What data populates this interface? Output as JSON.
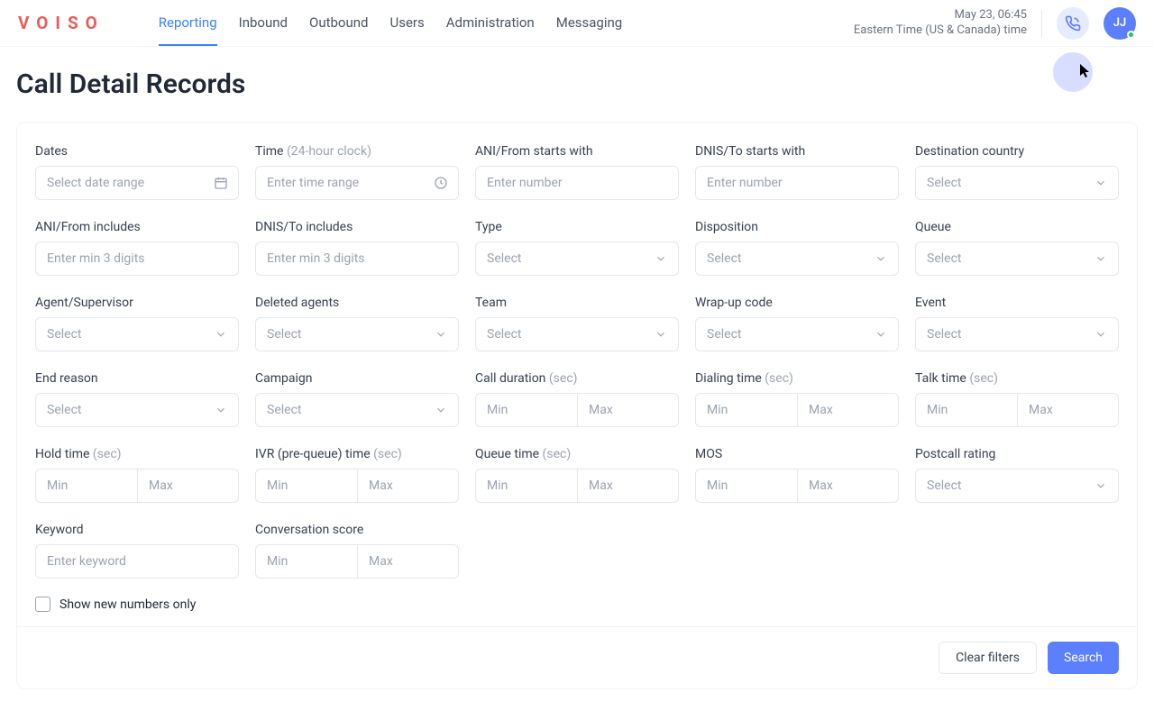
{
  "header": {
    "logo": "VOISO",
    "nav": [
      "Reporting",
      "Inbound",
      "Outbound",
      "Users",
      "Administration",
      "Messaging"
    ],
    "datetime": {
      "line1": "May 23, 06:45",
      "line2": "Eastern Time (US & Canada) time"
    },
    "avatar_initials": "JJ"
  },
  "page": {
    "title": "Call Detail Records"
  },
  "filters": {
    "dates": {
      "label": "Dates",
      "placeholder": "Select date range"
    },
    "time": {
      "label": "Time ",
      "hint": "(24-hour clock)",
      "placeholder": "Enter time range"
    },
    "ani_starts": {
      "label": "ANI/From starts with",
      "placeholder": "Enter number"
    },
    "dnis_starts": {
      "label": "DNIS/To starts with",
      "placeholder": "Enter number"
    },
    "dest_country": {
      "label": "Destination country",
      "placeholder": "Select"
    },
    "ani_includes": {
      "label": "ANI/From includes",
      "placeholder": "Enter min 3 digits"
    },
    "dnis_includes": {
      "label": "DNIS/To includes",
      "placeholder": "Enter min 3 digits"
    },
    "type": {
      "label": "Type",
      "placeholder": "Select"
    },
    "disposition": {
      "label": "Disposition",
      "placeholder": "Select"
    },
    "queue": {
      "label": "Queue",
      "placeholder": "Select"
    },
    "agent": {
      "label": "Agent/Supervisor",
      "placeholder": "Select"
    },
    "deleted_agents": {
      "label": "Deleted agents",
      "placeholder": "Select"
    },
    "team": {
      "label": "Team",
      "placeholder": "Select"
    },
    "wrap_up": {
      "label": "Wrap-up code",
      "placeholder": "Select"
    },
    "event": {
      "label": "Event",
      "placeholder": "Select"
    },
    "end_reason": {
      "label": "End reason",
      "placeholder": "Select"
    },
    "campaign": {
      "label": "Campaign",
      "placeholder": "Select"
    },
    "call_duration": {
      "label": "Call duration ",
      "hint": "(sec)",
      "min": "Min",
      "max": "Max"
    },
    "dialing_time": {
      "label": "Dialing time ",
      "hint": "(sec)",
      "min": "Min",
      "max": "Max"
    },
    "talk_time": {
      "label": "Talk time ",
      "hint": "(sec)",
      "min": "Min",
      "max": "Max"
    },
    "hold_time": {
      "label": "Hold time ",
      "hint": "(sec)",
      "min": "Min",
      "max": "Max"
    },
    "ivr_time": {
      "label": "IVR (pre-queue) time ",
      "hint": "(sec)",
      "min": "Min",
      "max": "Max"
    },
    "queue_time": {
      "label": "Queue time ",
      "hint": "(sec)",
      "min": "Min",
      "max": "Max"
    },
    "mos": {
      "label": "MOS",
      "min": "Min",
      "max": "Max"
    },
    "postcall": {
      "label": "Postcall rating",
      "placeholder": "Select"
    },
    "keyword": {
      "label": "Keyword",
      "placeholder": "Enter keyword"
    },
    "conv_score": {
      "label": "Conversation score",
      "min": "Min",
      "max": "Max"
    }
  },
  "checkbox": {
    "label": "Show new numbers only"
  },
  "actions": {
    "clear": "Clear filters",
    "search": "Search"
  }
}
